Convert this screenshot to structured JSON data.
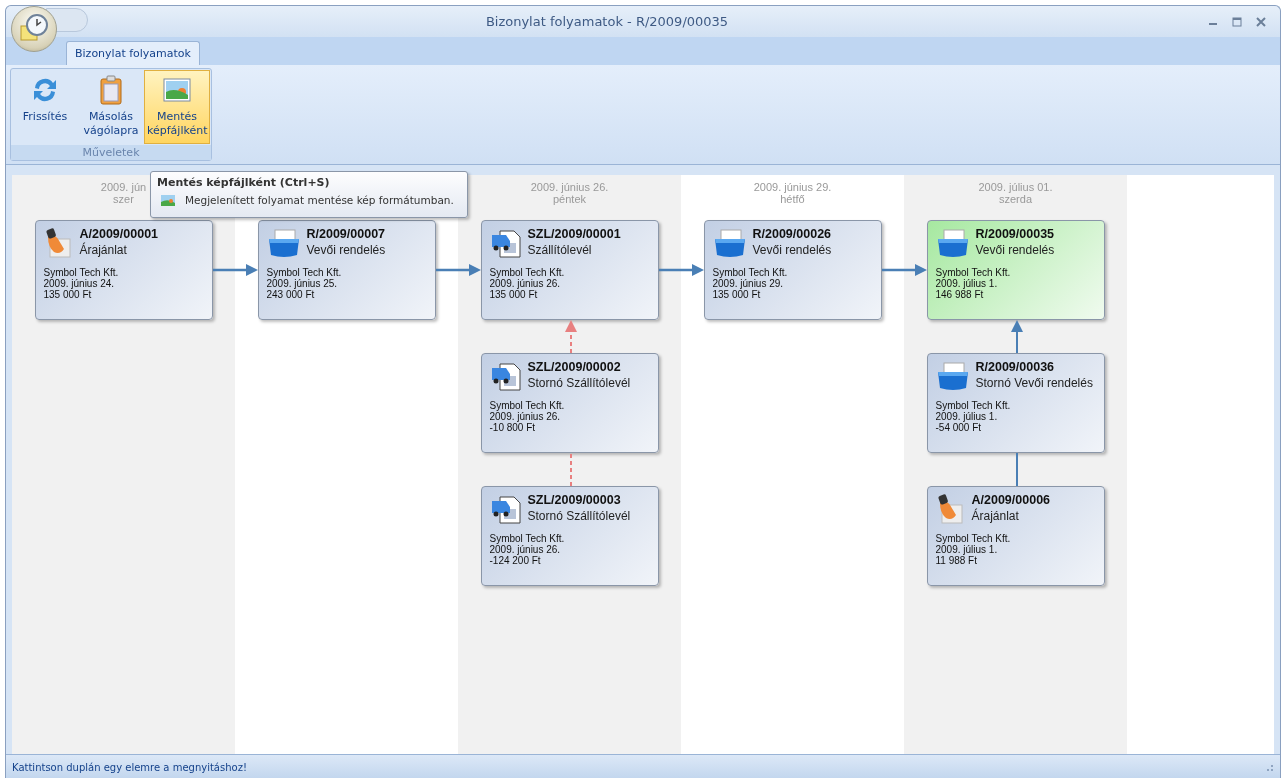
{
  "window": {
    "title": "Bizonylat folyamatok - R/2009/00035"
  },
  "ribbon": {
    "tabs": [
      {
        "label": "Bizonylat folyamatok",
        "selected": true
      }
    ],
    "groups": [
      {
        "label": "Műveletek",
        "buttons": [
          {
            "kind": "refresh",
            "label": "Frissítés",
            "hovered": false
          },
          {
            "kind": "clipboard",
            "label": "Másolás vágólapra",
            "hovered": false
          },
          {
            "kind": "image",
            "label": "Mentés képfájlként",
            "hovered": true
          }
        ]
      }
    ]
  },
  "tooltip": {
    "title": "Mentés képfájlként (Ctrl+S)",
    "text": "Megjelenített folyamat mentése kép formátumban."
  },
  "columns": [
    {
      "date": "2009. jún",
      "day": "szer",
      "cards": [
        {
          "kind": "offer",
          "number": "A/2009/00001",
          "type": "Árajánlat",
          "partner": "Symbol Tech Kft.",
          "date": "2009. június 24.",
          "amount": "135 000 Ft",
          "current": false,
          "link_right": true,
          "link_dashed": false
        }
      ]
    },
    {
      "cards": [
        {
          "kind": "order",
          "number": "R/2009/00007",
          "type": "Vevői rendelés",
          "partner": "Symbol Tech Kft.",
          "date": "2009. június 25.",
          "amount": "243 000 Ft",
          "current": false,
          "link_right": true,
          "link_dashed": false
        }
      ]
    },
    {
      "date": "2009. június 26.",
      "day": "péntek",
      "cards": [
        {
          "kind": "delivery",
          "number": "SZL/2009/00001",
          "type": "Szállítólevél",
          "partner": "Symbol Tech Kft.",
          "date": "2009. június 26.",
          "amount": "135 000 Ft",
          "current": false,
          "link_right": true,
          "link_dashed": false
        },
        {
          "kind": "delivery",
          "number": "SZL/2009/00002",
          "type": "Stornó Szállítólevél",
          "partner": "Symbol Tech Kft.",
          "date": "2009. június 26.",
          "amount": "-10 800 Ft",
          "current": false,
          "link_up": true,
          "link_up_head": true,
          "link_dashed": true
        },
        {
          "kind": "delivery",
          "number": "SZL/2009/00003",
          "type": "Stornó Szállítólevél",
          "partner": "Symbol Tech Kft.",
          "date": "2009. június 26.",
          "amount": "-124 200 Ft",
          "current": false,
          "link_up": true,
          "link_up_head": false,
          "link_dashed": true
        }
      ]
    },
    {
      "date": "2009. június 29.",
      "day": "hétfő",
      "cards": [
        {
          "kind": "order",
          "number": "R/2009/00026",
          "type": "Vevői rendelés",
          "partner": "Symbol Tech Kft.",
          "date": "2009. június 29.",
          "amount": "135 000 Ft",
          "current": false,
          "link_right": true,
          "link_dashed": false
        }
      ]
    },
    {
      "date": "2009. július 01.",
      "day": "szerda",
      "cards": [
        {
          "kind": "order",
          "number": "R/2009/00035",
          "type": "Vevői rendelés",
          "partner": "Symbol Tech Kft.",
          "date": "2009. július 1.",
          "amount": "146 988 Ft",
          "current": true,
          "link_right": false
        },
        {
          "kind": "order",
          "number": "R/2009/00036",
          "type": "Stornó Vevői rendelés",
          "partner": "Symbol Tech Kft.",
          "date": "2009. július 1.",
          "amount": "-54 000 Ft",
          "current": false,
          "link_up": true,
          "link_up_head": true,
          "link_dashed": false
        },
        {
          "kind": "offer",
          "number": "A/2009/00006",
          "type": "Árajánlat",
          "partner": "Symbol Tech Kft.",
          "date": "2009. július 1.",
          "amount": "11 988 Ft",
          "current": false,
          "link_up": true,
          "link_up_head": false,
          "link_dashed": false
        }
      ]
    }
  ],
  "status_bar": {
    "text": "Kattintson duplán egy elemre a megnyitáshoz!"
  }
}
